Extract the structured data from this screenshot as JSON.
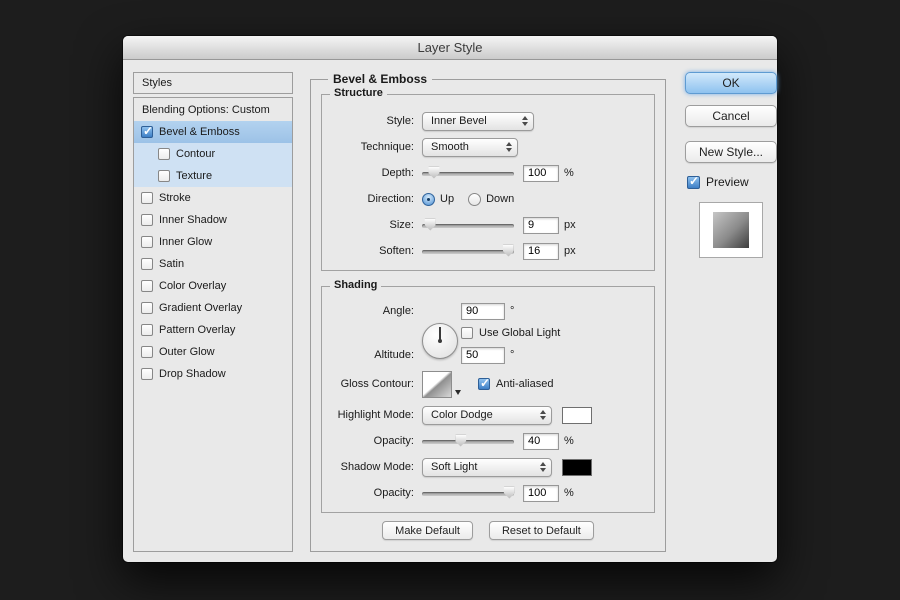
{
  "window": {
    "title": "Layer Style"
  },
  "styles_panel": {
    "header": "Styles",
    "blending_options": "Blending Options: Custom",
    "items": [
      {
        "label": "Bevel & Emboss",
        "checked": true
      },
      {
        "label": "Contour",
        "checked": false
      },
      {
        "label": "Texture",
        "checked": false
      },
      {
        "label": "Stroke",
        "checked": false
      },
      {
        "label": "Inner Shadow",
        "checked": false
      },
      {
        "label": "Inner Glow",
        "checked": false
      },
      {
        "label": "Satin",
        "checked": false
      },
      {
        "label": "Color Overlay",
        "checked": false
      },
      {
        "label": "Gradient Overlay",
        "checked": false
      },
      {
        "label": "Pattern Overlay",
        "checked": false
      },
      {
        "label": "Outer Glow",
        "checked": false
      },
      {
        "label": "Drop Shadow",
        "checked": false
      }
    ]
  },
  "bevel": {
    "title": "Bevel & Emboss",
    "structure": {
      "title": "Structure",
      "style": {
        "label": "Style:",
        "value": "Inner Bevel"
      },
      "technique": {
        "label": "Technique:",
        "value": "Smooth"
      },
      "depth": {
        "label": "Depth:",
        "value": "100",
        "unit": "%"
      },
      "direction": {
        "label": "Direction:",
        "up": "Up",
        "down": "Down",
        "up_selected": true,
        "down_selected": false
      },
      "size": {
        "label": "Size:",
        "value": "9",
        "unit": "px"
      },
      "soften": {
        "label": "Soften:",
        "value": "16",
        "unit": "px"
      }
    },
    "shading": {
      "title": "Shading",
      "angle": {
        "label": "Angle:",
        "value": "90",
        "unit": "°"
      },
      "use_global_light": {
        "label": "Use Global Light",
        "checked": false
      },
      "altitude": {
        "label": "Altitude:",
        "value": "50",
        "unit": "°"
      },
      "gloss_contour": {
        "label": "Gloss Contour:"
      },
      "anti_aliased": {
        "label": "Anti-aliased",
        "checked": true
      },
      "highlight_mode": {
        "label": "Highlight Mode:",
        "value": "Color Dodge",
        "swatch": "#ffffff"
      },
      "highlight_opacity": {
        "label": "Opacity:",
        "value": "40",
        "unit": "%"
      },
      "shadow_mode": {
        "label": "Shadow Mode:",
        "value": "Soft Light",
        "swatch": "#000000"
      },
      "shadow_opacity": {
        "label": "Opacity:",
        "value": "100",
        "unit": "%"
      }
    },
    "footer": {
      "make_default": "Make Default",
      "reset_default": "Reset to Default"
    }
  },
  "actions": {
    "ok": "OK",
    "cancel": "Cancel",
    "new_style": "New Style...",
    "preview": {
      "label": "Preview",
      "checked": true
    }
  }
}
